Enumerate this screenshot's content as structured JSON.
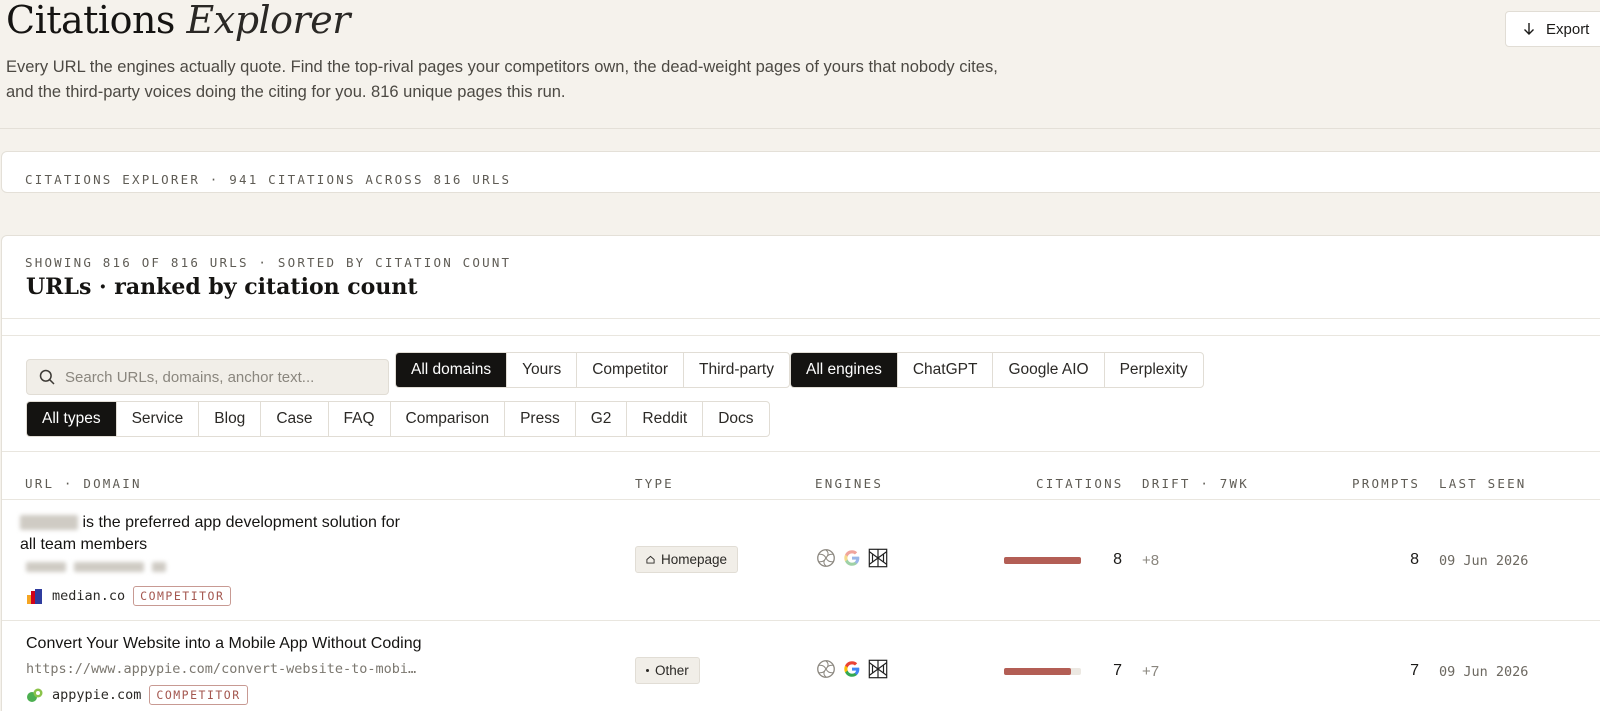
{
  "header": {
    "title_plain": "Citations",
    "title_italic": "Explorer",
    "subtitle": "Every URL the engines actually quote. Find the top-rival pages your competitors own, the dead-weight pages of yours that nobody cites, and the third-party voices doing the citing for you. 816 unique pages this run.",
    "export_label": "Export",
    "export_icon": "arrow-down-icon"
  },
  "summary": {
    "caption": "Citations Explorer · 941 citations across 816 URLs"
  },
  "table": {
    "showing_caption": "Showing 816 of 816 URLs · sorted by citation count",
    "title": "URLs · ranked by citation count",
    "search_placeholder": "Search URLs, domains, anchor text...",
    "domain_filters": [
      {
        "label": "All domains",
        "active": true
      },
      {
        "label": "Yours",
        "active": false
      },
      {
        "label": "Competitor",
        "active": false
      },
      {
        "label": "Third-party",
        "active": false
      }
    ],
    "engine_filters": [
      {
        "label": "All engines",
        "active": true
      },
      {
        "label": "ChatGPT",
        "active": false
      },
      {
        "label": "Google AIO",
        "active": false
      },
      {
        "label": "Perplexity",
        "active": false
      }
    ],
    "type_filters": [
      {
        "label": "All types",
        "active": true
      },
      {
        "label": "Service",
        "active": false
      },
      {
        "label": "Blog",
        "active": false
      },
      {
        "label": "Case",
        "active": false
      },
      {
        "label": "FAQ",
        "active": false
      },
      {
        "label": "Comparison",
        "active": false
      },
      {
        "label": "Press",
        "active": false
      },
      {
        "label": "G2",
        "active": false
      },
      {
        "label": "Reddit",
        "active": false
      },
      {
        "label": "Docs",
        "active": false
      }
    ],
    "columns": {
      "url": "URL · Domain",
      "type": "Type",
      "engines": "Engines",
      "citations": "Citations",
      "drift": "Drift · 7wk",
      "prompts": "Prompts",
      "last_seen": "Last seen"
    },
    "rows": [
      {
        "title": "is the preferred app development solution for all team members",
        "url": "",
        "domain": "median.co",
        "badge": "COMPETITOR",
        "type_label": "Homepage",
        "type_icon": "home-icon",
        "engines": [
          "chatgpt-icon",
          "google-icon",
          "perplexity-icon"
        ],
        "citations": "8",
        "citation_share": 1.0,
        "drift": "+8",
        "prompts": "8",
        "last_seen": "09 Jun 2026"
      },
      {
        "title": "Convert Your Website into a Mobile App Without Coding",
        "url": "https://www.appypie.com/convert-website-to-mobi…",
        "domain": "appypie.com",
        "badge": "COMPETITOR",
        "type_label": "Other",
        "type_icon": "dot-icon",
        "engines": [
          "chatgpt-icon",
          "google-icon",
          "perplexity-icon"
        ],
        "citations": "7",
        "citation_share": 0.875,
        "drift": "+7",
        "prompts": "7",
        "last_seen": "09 Jun 2026"
      }
    ]
  }
}
